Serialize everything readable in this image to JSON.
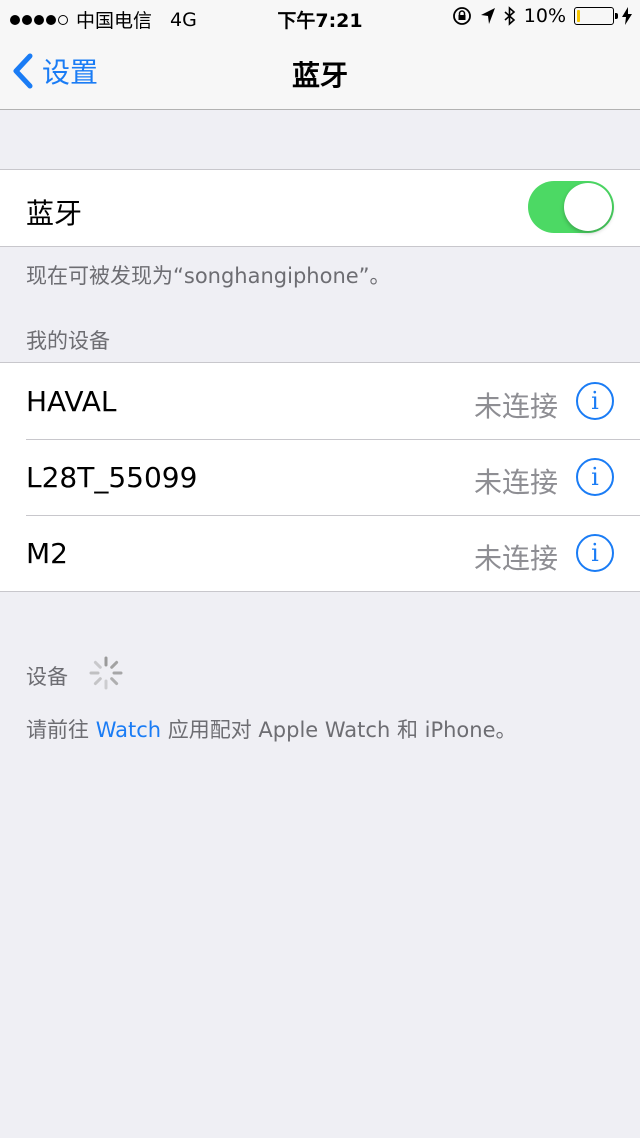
{
  "status_bar": {
    "carrier": "中国电信",
    "network": "4G",
    "time": "下午7:21",
    "battery": "10%",
    "battery_level": 0.1,
    "signal_bars_filled": 4,
    "signal_bars_total": 5
  },
  "nav": {
    "back_label": "设置",
    "title": "蓝牙"
  },
  "bluetooth": {
    "label": "蓝牙",
    "enabled": true,
    "toggle_color": "#4cd964",
    "discoverable_text": "现在可被发现为“songhangiphone”。"
  },
  "my_devices": {
    "header": "我的设备",
    "items": [
      {
        "name": "HAVAL",
        "status": "未连接"
      },
      {
        "name": "L28T_55099",
        "status": "未连接"
      },
      {
        "name": "M2",
        "status": "未连接"
      }
    ]
  },
  "devices": {
    "header": "设备",
    "hint_prefix": "请前往 ",
    "hint_link": "Watch",
    "hint_suffix": " 应用配对 Apple Watch 和 iPhone。"
  },
  "colors": {
    "accent": "#1a7cf5",
    "background": "#efeff4",
    "secondary_text": "#8e8e93"
  }
}
